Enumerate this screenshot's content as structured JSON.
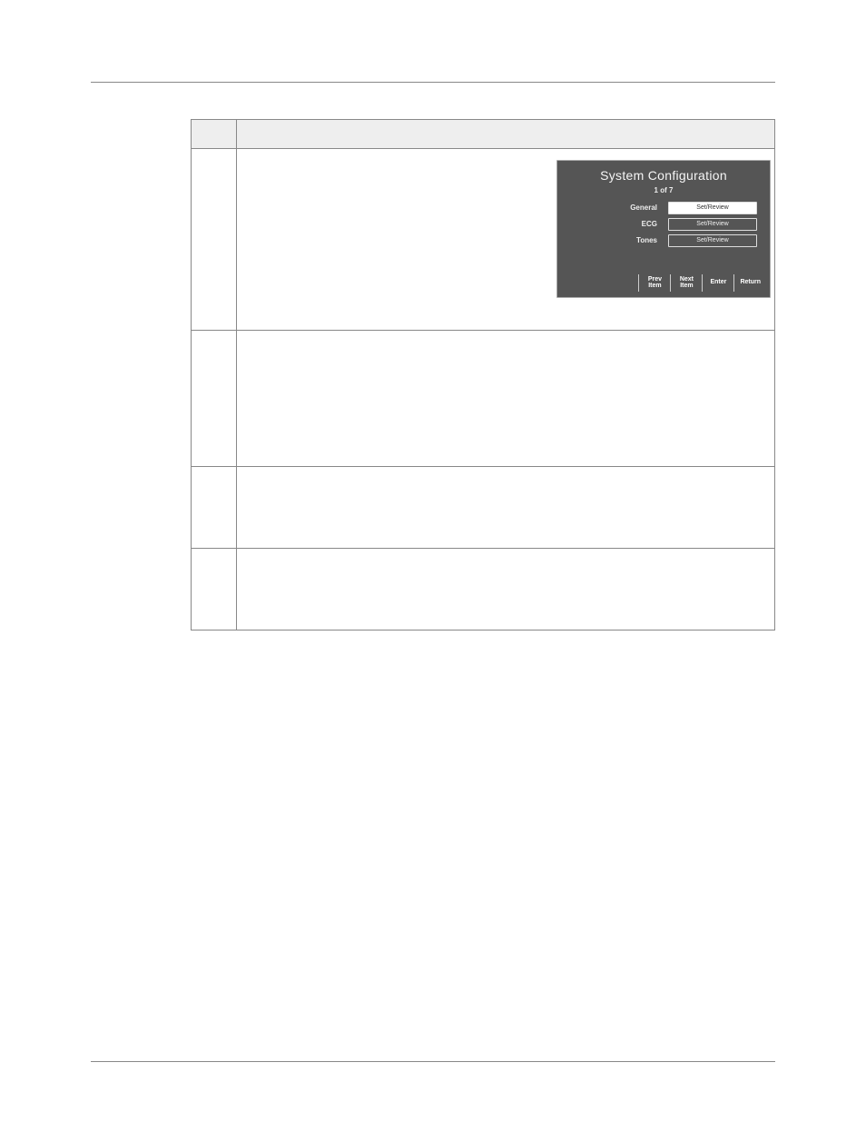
{
  "table": {
    "header": {
      "step": "",
      "action": ""
    },
    "rows": [
      {
        "step": "",
        "action": ""
      },
      {
        "step": "",
        "action": ""
      },
      {
        "step": "",
        "action": ""
      },
      {
        "step": "",
        "action": ""
      }
    ]
  },
  "panel": {
    "title": "System Configuration",
    "page": "1 of 7",
    "fields": [
      {
        "label": "General",
        "value": "Set/Review",
        "selected": true
      },
      {
        "label": "ECG",
        "value": "Set/Review",
        "selected": false
      },
      {
        "label": "Tones",
        "value": "Set/Review",
        "selected": false
      }
    ],
    "buttons": {
      "prev": "Prev\nItem",
      "next": "Next\nItem",
      "enter": "Enter",
      "return": "Return"
    }
  }
}
